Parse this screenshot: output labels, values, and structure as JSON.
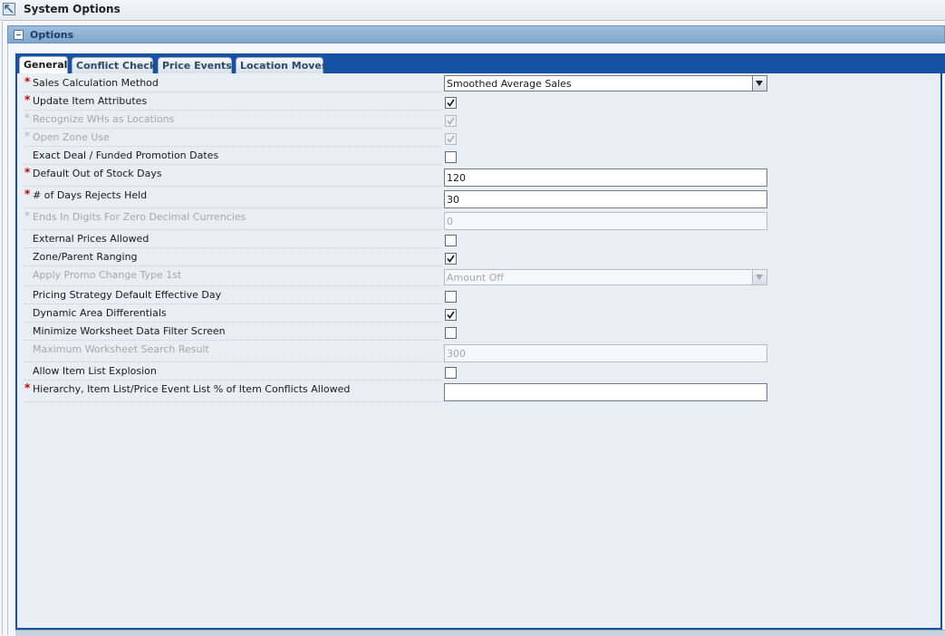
{
  "window": {
    "title": "System Options"
  },
  "panel": {
    "title": "Options"
  },
  "tabs": [
    {
      "label": "General"
    },
    {
      "label": "Conflict Check"
    },
    {
      "label": "Price Events"
    },
    {
      "label": "Location Moves"
    }
  ],
  "active_tab": "General",
  "required_marker": "*",
  "form": {
    "sales_calc_method": {
      "label": "Sales Calculation Method",
      "required": true,
      "value": "Smoothed Average Sales"
    },
    "update_item_attributes": {
      "label": "Update Item Attributes",
      "required": true,
      "checked": true
    },
    "recognize_whs": {
      "label": "Recognize WHs as Locations",
      "required": true,
      "disabled": true,
      "checked": true
    },
    "open_zone_use": {
      "label": "Open Zone Use",
      "required": true,
      "disabled": true,
      "checked": true
    },
    "exact_deal": {
      "label": "Exact Deal / Funded Promotion Dates",
      "checked": false
    },
    "default_oos_days": {
      "label": "Default Out of Stock Days",
      "required": true,
      "value": "120"
    },
    "days_rejects_held": {
      "label": "# of Days Rejects Held",
      "required": true,
      "value": "30"
    },
    "ends_in_digits": {
      "label": "Ends In Digits For Zero Decimal Currencies",
      "required": true,
      "disabled": true,
      "value": "0"
    },
    "external_prices": {
      "label": "External Prices Allowed",
      "checked": false
    },
    "zone_parent_ranging": {
      "label": "Zone/Parent Ranging",
      "checked": true
    },
    "apply_promo_change": {
      "label": "Apply Promo Change Type 1st",
      "disabled": true,
      "value": "Amount Off"
    },
    "pricing_strategy_default": {
      "label": "Pricing Strategy Default Effective Day",
      "checked": false
    },
    "dynamic_area_diff": {
      "label": "Dynamic Area Differentials",
      "checked": true
    },
    "minimize_worksheet": {
      "label": "Minimize Worksheet Data Filter Screen",
      "checked": false
    },
    "max_worksheet_search": {
      "label": "Maximum Worksheet Search Result",
      "disabled": true,
      "value": "300"
    },
    "allow_item_list": {
      "label": "Allow Item List Explosion",
      "checked": false
    },
    "hierarchy_conflicts": {
      "label": "Hierarchy, Item List/Price Event List % of Item Conflicts Allowed",
      "required": true,
      "value": ""
    }
  }
}
